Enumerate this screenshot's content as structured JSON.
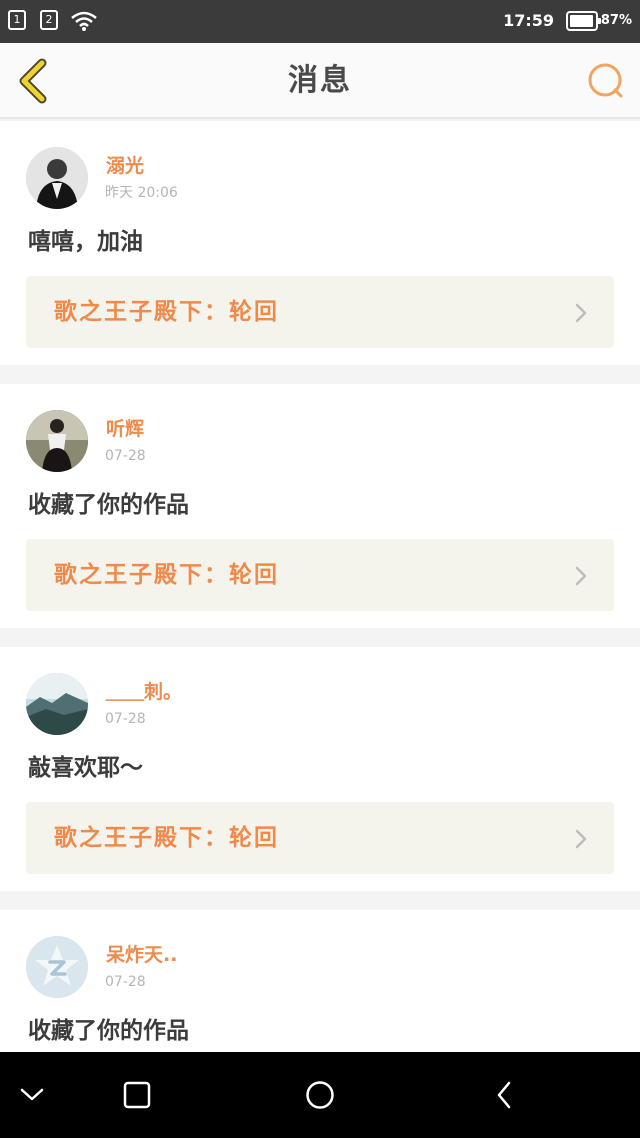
{
  "status_bar": {
    "sim1": "1",
    "sim2": "2",
    "time": "17:59",
    "battery_percent": "87%",
    "battery_level": 0.87,
    "icons": [
      "sim-1-icon",
      "sim-2-icon",
      "wifi-icon",
      "battery-icon"
    ]
  },
  "header": {
    "title": "消息",
    "back_icon": "back-arrow-icon",
    "search_icon": "search-icon",
    "accent_back": "#f2d22e",
    "accent_search": "#f3a45c"
  },
  "messages": [
    {
      "username": "溺光",
      "time": "昨天 20:06",
      "text": "嘻嘻，加油",
      "work": "歌之王子殿下：轮回"
    },
    {
      "username": "听辉",
      "time": "07-28",
      "text": "收藏了你的作品",
      "work": "歌之王子殿下：轮回"
    },
    {
      "username": "＿＿刺。",
      "time": "07-28",
      "text": "敲喜欢耶～",
      "work": "歌之王子殿下：轮回"
    },
    {
      "username": "呆炸天..",
      "time": "07-28",
      "text": "收藏了你的作品"
    }
  ],
  "nav_bar": {
    "icons": [
      "collapse-icon",
      "recents-icon",
      "home-icon",
      "back-icon"
    ]
  },
  "colors": {
    "username": "#f08a4b",
    "work_link_bg": "#f4f4ec",
    "status_bar": "#3b3b3b",
    "nav_bar": "#000000"
  }
}
